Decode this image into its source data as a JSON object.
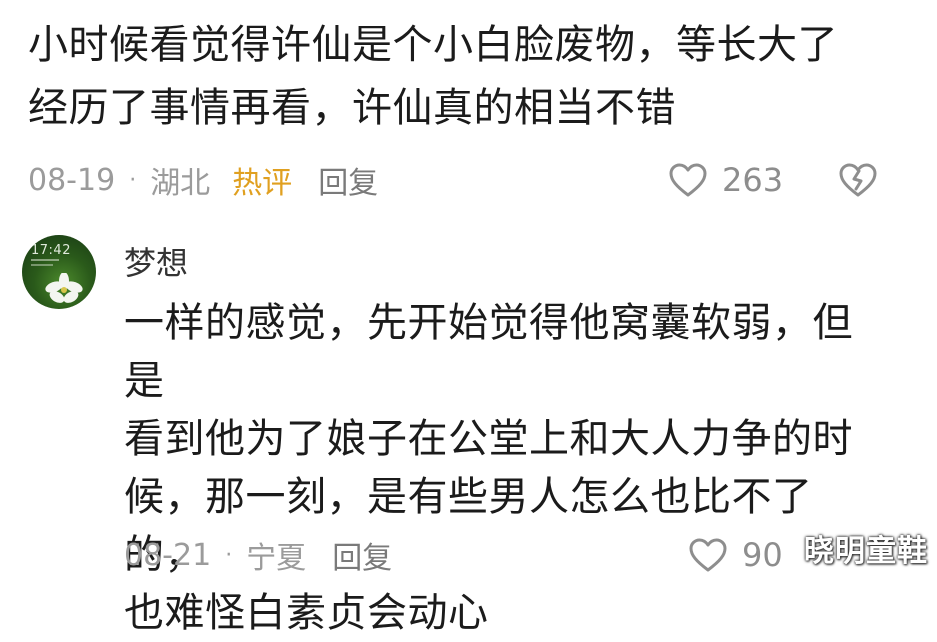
{
  "comment": {
    "lines": [
      "小时候看觉得许仙是个小白脸废物，等长大了",
      "经历了事情再看，许仙真的相当不错"
    ],
    "date": "08-19",
    "location": "湖北",
    "badge": "热评",
    "reply_label": "回复",
    "like_count": "263"
  },
  "reply": {
    "username": "梦想",
    "avatar_clock": "17:42",
    "lines": [
      "一样的感觉，先开始觉得他窝囊软弱，但是",
      "看到他为了娘子在公堂上和大人力争的时",
      "候，那一刻，是有些男人怎么也比不了的，",
      "也难怪白素贞会动心"
    ],
    "date": "08-21",
    "location": "宁夏",
    "reply_label": "回复",
    "like_count": "90"
  },
  "separator": "·",
  "watermark": "晓明童鞋",
  "icons": [
    "heart-icon",
    "dislike-heart-icon"
  ],
  "colors": {
    "hot_badge": "#e0a020",
    "meta": "#9b9b9b",
    "text": "#1b1b1b"
  }
}
